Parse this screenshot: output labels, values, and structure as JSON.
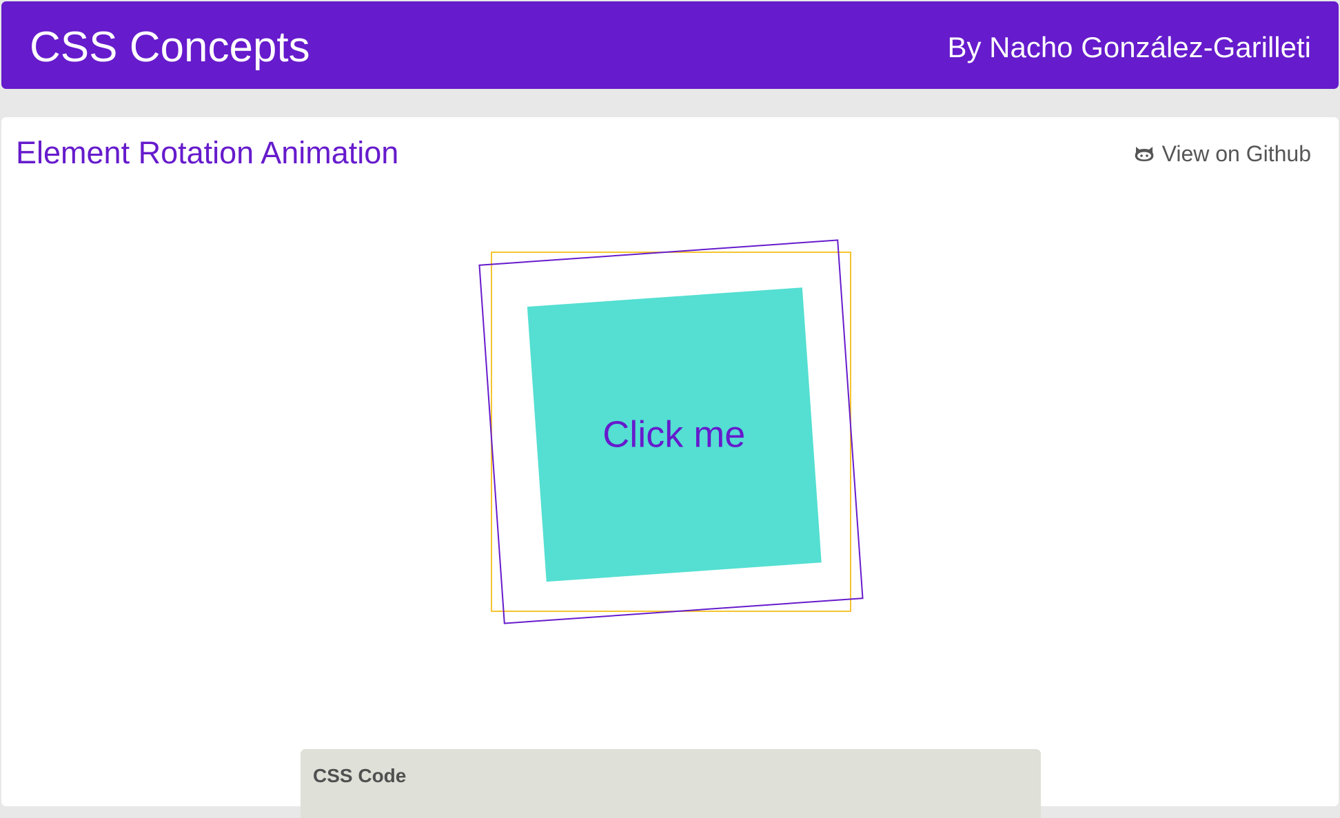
{
  "header": {
    "title": "CSS Concepts",
    "author": "By Nacho González-Garilleti"
  },
  "demo": {
    "title": "Element Rotation Animation",
    "github_link": "View on Github",
    "github_icon": "github-icon",
    "button_label": "Click me",
    "rotation_deg": -4
  },
  "code_panel": {
    "title": "CSS Code"
  },
  "colors": {
    "brand": "#661bcc",
    "box": "#54dfd2",
    "outline_original": "#f4c430",
    "outline_rotated": "#661bcc",
    "code_panel_bg": "#dfe0d8"
  }
}
